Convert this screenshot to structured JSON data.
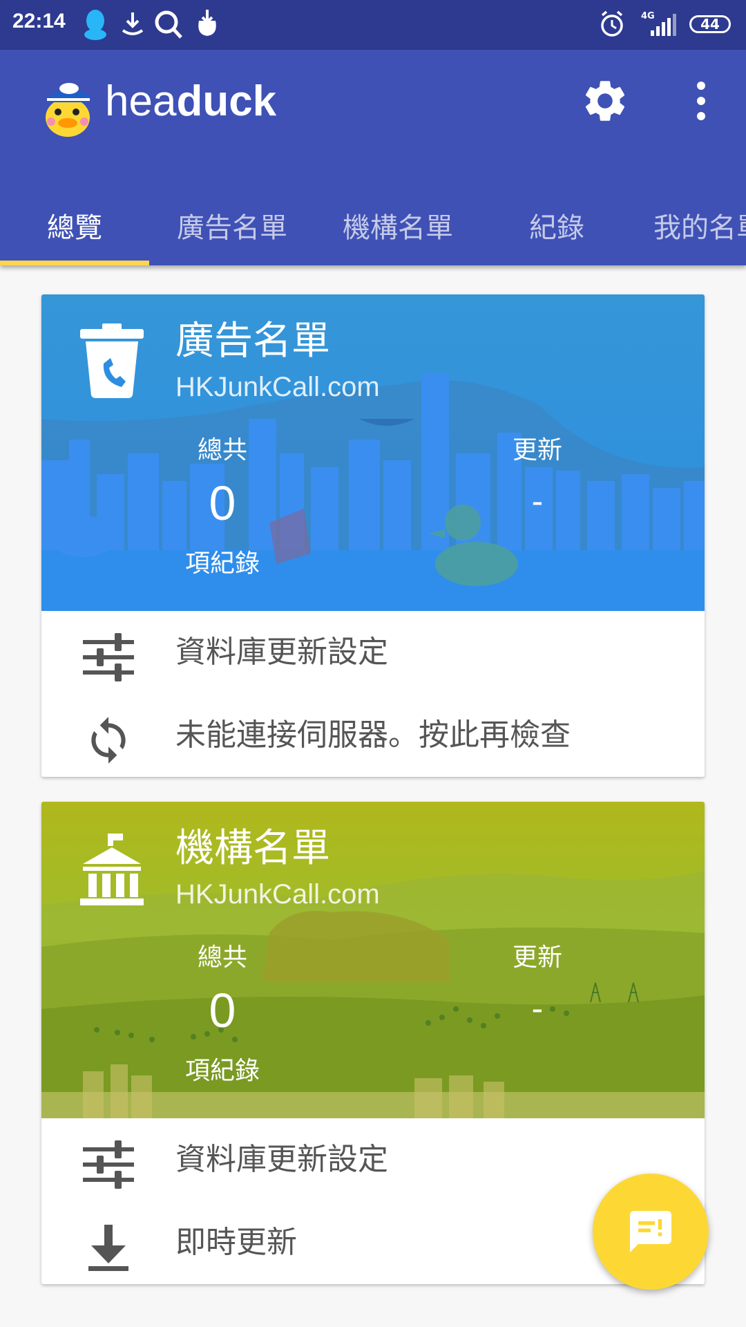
{
  "status_bar": {
    "time": "22:14",
    "network": "4G",
    "battery": "44"
  },
  "app_bar": {
    "title_light": "hea",
    "title_bold": "duck",
    "settings_icon": "gear-icon",
    "more_icon": "more-vert-icon"
  },
  "tabs": [
    {
      "label": "總覽",
      "active": true
    },
    {
      "label": "廣告名單",
      "active": false
    },
    {
      "label": "機構名單",
      "active": false
    },
    {
      "label": "紀錄",
      "active": false
    },
    {
      "label": "我的名單",
      "active": false
    }
  ],
  "cards": [
    {
      "title": "廣告名單",
      "subtitle": "HKJunkCall.com",
      "icon": "trash-phone-icon",
      "total_label": "總共",
      "total_value": "0",
      "total_unit": "項紀錄",
      "update_label": "更新",
      "update_value": "-",
      "theme_color": "#2196f3",
      "rows": [
        {
          "icon": "tune-icon",
          "label": "資料庫更新設定"
        },
        {
          "icon": "refresh-icon",
          "label": "未能連接伺服器。按此再檢查"
        }
      ]
    },
    {
      "title": "機構名單",
      "subtitle": "HKJunkCall.com",
      "icon": "bank-icon",
      "total_label": "總共",
      "total_value": "0",
      "total_unit": "項紀錄",
      "update_label": "更新",
      "update_value": "-",
      "theme_color": "#9ab22a",
      "rows": [
        {
          "icon": "tune-icon",
          "label": "資料庫更新設定"
        },
        {
          "icon": "download-icon",
          "label": "即時更新"
        }
      ]
    }
  ],
  "fab": {
    "icon": "feedback-icon",
    "color": "#fdd835"
  },
  "colors": {
    "primary": "#3f51b5",
    "status_bar": "#2e3a8f",
    "accent": "#ffd54f"
  }
}
